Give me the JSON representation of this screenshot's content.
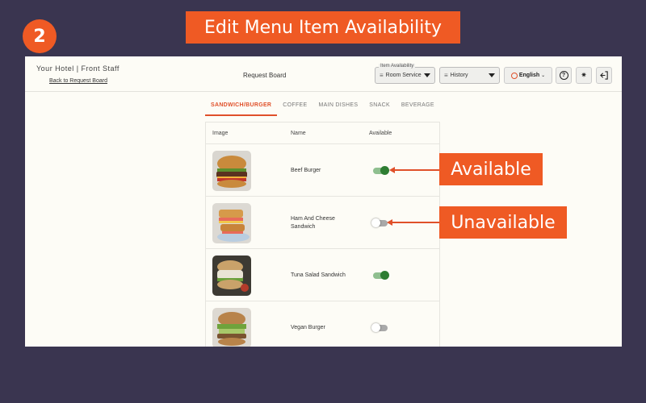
{
  "step_number": "2",
  "banner_title": "Edit Menu Item Availability",
  "header": {
    "brand": "Your Hotel | Front Staff",
    "back_link": "Back to Request Board",
    "board_title": "Request Board",
    "item_availability_label": "Item Availability",
    "service_select_value": "Room Service",
    "history_select_value": "History",
    "language_label": "English",
    "language_caret": "⌄"
  },
  "tabs": [
    {
      "label": "SANDWICH/BURGER",
      "active": true
    },
    {
      "label": "COFFEE",
      "active": false
    },
    {
      "label": "MAIN DISHES",
      "active": false
    },
    {
      "label": "SNACK",
      "active": false
    },
    {
      "label": "BEVERAGE",
      "active": false
    }
  ],
  "table": {
    "columns": [
      "Image",
      "Name",
      "Available"
    ],
    "rows": [
      {
        "name": "Beef Burger",
        "available": true
      },
      {
        "name": "Ham And Cheese Sandwich",
        "available": false
      },
      {
        "name": "Tuna Salad Sandwich",
        "available": true
      },
      {
        "name": "Vegan Burger",
        "available": false
      }
    ]
  },
  "callouts": {
    "available": "Available",
    "unavailable": "Unavailable"
  },
  "colors": {
    "accent": "#ef5a24",
    "toggle_on": "#2e7d32",
    "toggle_off": "#a9a9a9",
    "backdrop": "#3a3550"
  },
  "icons": [
    "filter-lines-icon",
    "chevron-down-icon",
    "globe-icon",
    "help-icon",
    "sun-icon",
    "logout-icon"
  ]
}
